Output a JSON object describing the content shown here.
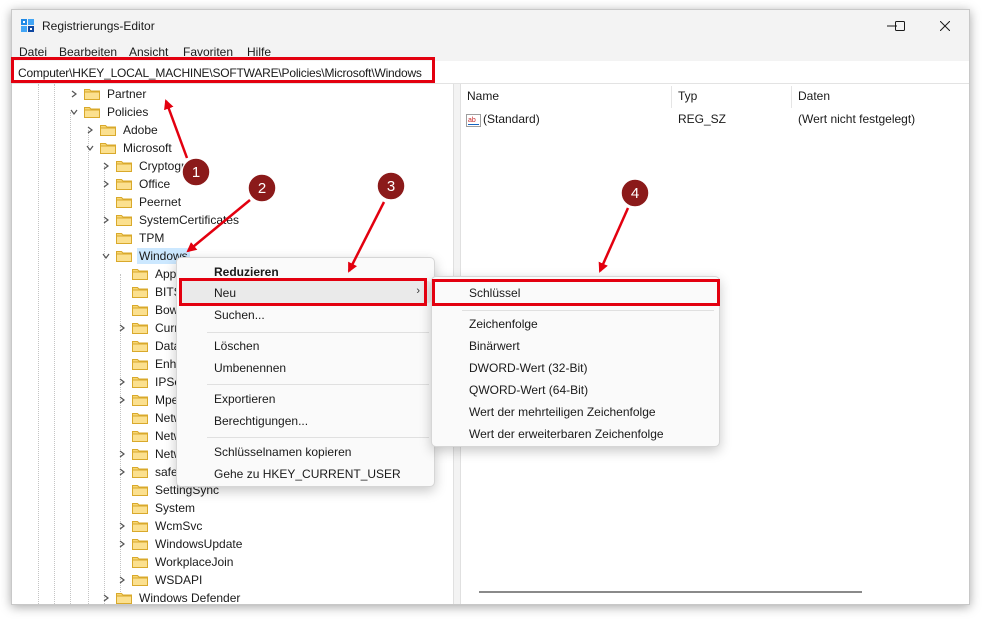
{
  "window": {
    "title": "Registrierungs-Editor",
    "menu": [
      "Datei",
      "Bearbeiten",
      "Ansicht",
      "Favoriten",
      "Hilfe"
    ],
    "controls": [
      "minimize-icon",
      "maximize-icon",
      "close-icon"
    ]
  },
  "address": {
    "path": "Computer\\HKEY_LOCAL_MACHINE\\SOFTWARE\\Policies\\Microsoft\\Windows"
  },
  "tree": {
    "items": [
      {
        "label": "Partner",
        "expanded": false
      },
      {
        "label": "Policies",
        "expanded": true
      },
      {
        "label": "Adobe",
        "expanded": false
      },
      {
        "label": "Microsoft",
        "expanded": true
      },
      {
        "label": "Cryptogra",
        "expanded": false
      },
      {
        "label": "Office",
        "expanded": false
      },
      {
        "label": "Peernet",
        "expanded": null
      },
      {
        "label": "SystemCertificates",
        "expanded": false
      },
      {
        "label": "TPM",
        "expanded": null
      },
      {
        "label": "Windows",
        "expanded": true,
        "selected": true
      },
      {
        "label": "Appx",
        "expanded": null
      },
      {
        "label": "BITS",
        "expanded": null
      },
      {
        "label": "Bows",
        "expanded": null
      },
      {
        "label": "Curre",
        "expanded": false
      },
      {
        "label": "DataC",
        "expanded": null
      },
      {
        "label": "Enha",
        "expanded": null
      },
      {
        "label": "IPSec",
        "expanded": false
      },
      {
        "label": "Mpek",
        "expanded": false
      },
      {
        "label": "Netw",
        "expanded": null
      },
      {
        "label": "Netw",
        "expanded": null
      },
      {
        "label": "Netw",
        "expanded": false
      },
      {
        "label": "safer",
        "expanded": false
      },
      {
        "label": "SettingSync",
        "expanded": null
      },
      {
        "label": "System",
        "expanded": null
      },
      {
        "label": "WcmSvc",
        "expanded": false
      },
      {
        "label": "WindowsUpdate",
        "expanded": false
      },
      {
        "label": "WorkplaceJoin",
        "expanded": null
      },
      {
        "label": "WSDAPI",
        "expanded": false
      },
      {
        "label": "Windows Defender",
        "expanded": false
      }
    ]
  },
  "list": {
    "columns": [
      "Name",
      "Typ",
      "Daten"
    ],
    "rows": [
      {
        "icon": "string-value-icon",
        "name": "(Standard)",
        "type": "REG_SZ",
        "data": "(Wert nicht festgelegt)"
      }
    ]
  },
  "context_menu": {
    "collapse": "Reduzieren",
    "new": "Neu",
    "find": "Suchen...",
    "delete": "Löschen",
    "rename": "Umbenennen",
    "export": "Exportieren",
    "permissions": "Berechtigungen...",
    "copy_key_name": "Schlüsselnamen kopieren",
    "goto": "Gehe zu HKEY_CURRENT_USER"
  },
  "submenu": {
    "key": "Schlüssel",
    "string": "Zeichenfolge",
    "binary": "Binärwert",
    "dword": "DWORD-Wert (32-Bit)",
    "qword": "QWORD-Wert (64-Bit)",
    "multi_string": "Wert der mehrteiligen Zeichenfolge",
    "expandable_string": "Wert der erweiterbaren Zeichenfolge"
  },
  "annotations": {
    "badges": [
      "1",
      "2",
      "3",
      "4"
    ],
    "highlight_color": "#e3000f",
    "badge_color": "#8b1a1a"
  }
}
